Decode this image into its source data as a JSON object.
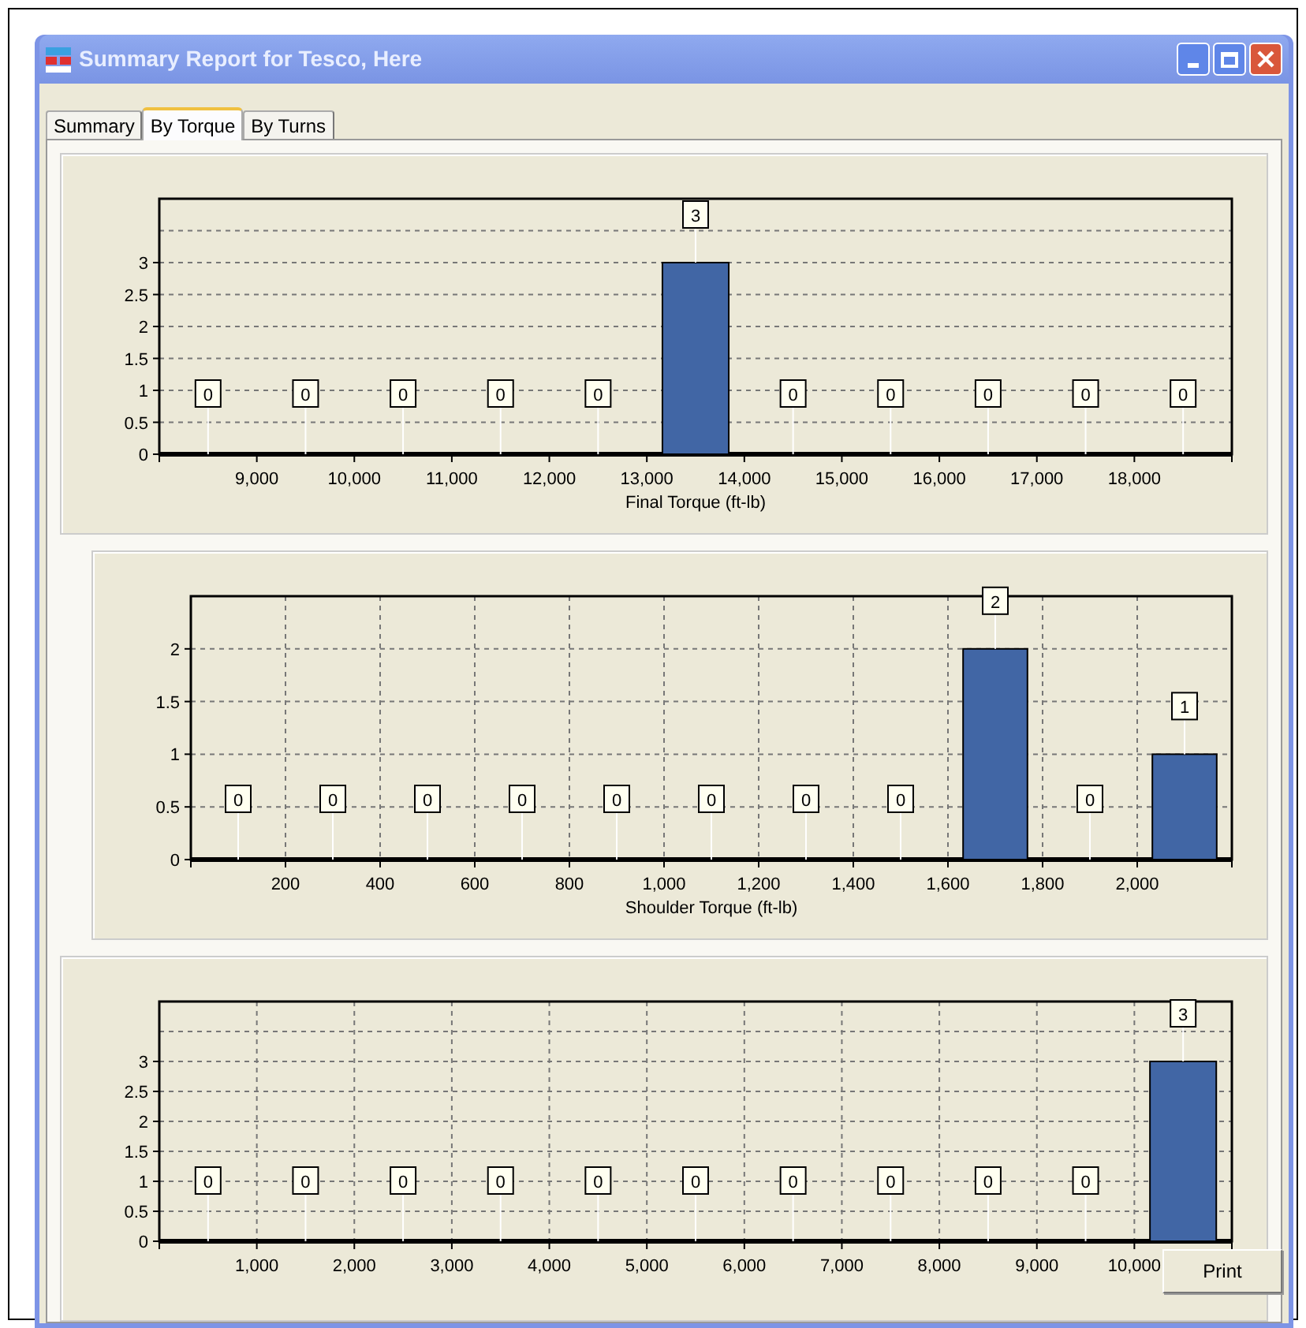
{
  "window": {
    "title": "Summary Report for Tesco, Here"
  },
  "tabs": [
    {
      "label": "Summary",
      "selected": false
    },
    {
      "label": "By Torque",
      "selected": true
    },
    {
      "label": "By Turns",
      "selected": false
    }
  ],
  "charts": [
    {
      "chart_data": {
        "type": "bar",
        "grid": "y",
        "xlabel": "Final Torque (ft-lb)",
        "x": [
          8500,
          9500,
          10500,
          11500,
          12500,
          13500,
          14500,
          15500,
          16500,
          17500,
          18500
        ],
        "values": [
          0,
          0,
          0,
          0,
          0,
          3,
          0,
          0,
          0,
          0,
          0
        ],
        "xlim": [
          8000,
          19000
        ],
        "ylim": [
          0,
          4
        ],
        "xticks": [
          {
            "value": 9000,
            "label": "9,000"
          },
          {
            "value": 10000,
            "label": "10,000"
          },
          {
            "value": 11000,
            "label": "11,000"
          },
          {
            "value": 12000,
            "label": "12,000"
          },
          {
            "value": 13000,
            "label": "13,000"
          },
          {
            "value": 14000,
            "label": "14,000"
          },
          {
            "value": 15000,
            "label": "15,000"
          },
          {
            "value": 16000,
            "label": "16,000"
          },
          {
            "value": 17000,
            "label": "17,000"
          },
          {
            "value": 18000,
            "label": "18,000"
          }
        ],
        "yticks": [
          0,
          0.5,
          1,
          1.5,
          2,
          2.5,
          3
        ],
        "data_labels": true
      }
    },
    {
      "chart_data": {
        "type": "bar",
        "grid": "both",
        "xlabel": "Shoulder Torque (ft-lb)",
        "x": [
          100,
          300,
          500,
          700,
          900,
          1100,
          1300,
          1500,
          1700,
          1900,
          2100
        ],
        "values": [
          0,
          0,
          0,
          0,
          0,
          0,
          0,
          0,
          2,
          0,
          1
        ],
        "xlim": [
          0,
          2200
        ],
        "ylim": [
          0,
          2.5
        ],
        "xticks": [
          {
            "value": 200,
            "label": "200"
          },
          {
            "value": 400,
            "label": "400"
          },
          {
            "value": 600,
            "label": "600"
          },
          {
            "value": 800,
            "label": "800"
          },
          {
            "value": 1000,
            "label": "1,000"
          },
          {
            "value": 1200,
            "label": "1,200"
          },
          {
            "value": 1400,
            "label": "1,400"
          },
          {
            "value": 1600,
            "label": "1,600"
          },
          {
            "value": 1800,
            "label": "1,800"
          },
          {
            "value": 2000,
            "label": "2,000"
          }
        ],
        "yticks": [
          0,
          0.5,
          1,
          1.5,
          2
        ],
        "data_labels": true
      }
    },
    {
      "chart_data": {
        "type": "bar",
        "grid": "both",
        "x": [
          500,
          1500,
          2500,
          3500,
          4500,
          5500,
          6500,
          7500,
          8500,
          9500,
          10500
        ],
        "values": [
          0,
          0,
          0,
          0,
          0,
          0,
          0,
          0,
          0,
          0,
          3
        ],
        "xlim": [
          0,
          11000
        ],
        "ylim": [
          0,
          4
        ],
        "xticks": [
          {
            "value": 1000,
            "label": "1,000"
          },
          {
            "value": 2000,
            "label": "2,000"
          },
          {
            "value": 3000,
            "label": "3,000"
          },
          {
            "value": 4000,
            "label": "4,000"
          },
          {
            "value": 5000,
            "label": "5,000"
          },
          {
            "value": 6000,
            "label": "6,000"
          },
          {
            "value": 7000,
            "label": "7,000"
          },
          {
            "value": 8000,
            "label": "8,000"
          },
          {
            "value": 9000,
            "label": "9,000"
          },
          {
            "value": 10000,
            "label": "10,000"
          }
        ],
        "yticks": [
          0,
          0.5,
          1,
          1.5,
          2,
          2.5,
          3
        ],
        "data_labels": true
      }
    }
  ],
  "print_button": {
    "label": "Print"
  }
}
